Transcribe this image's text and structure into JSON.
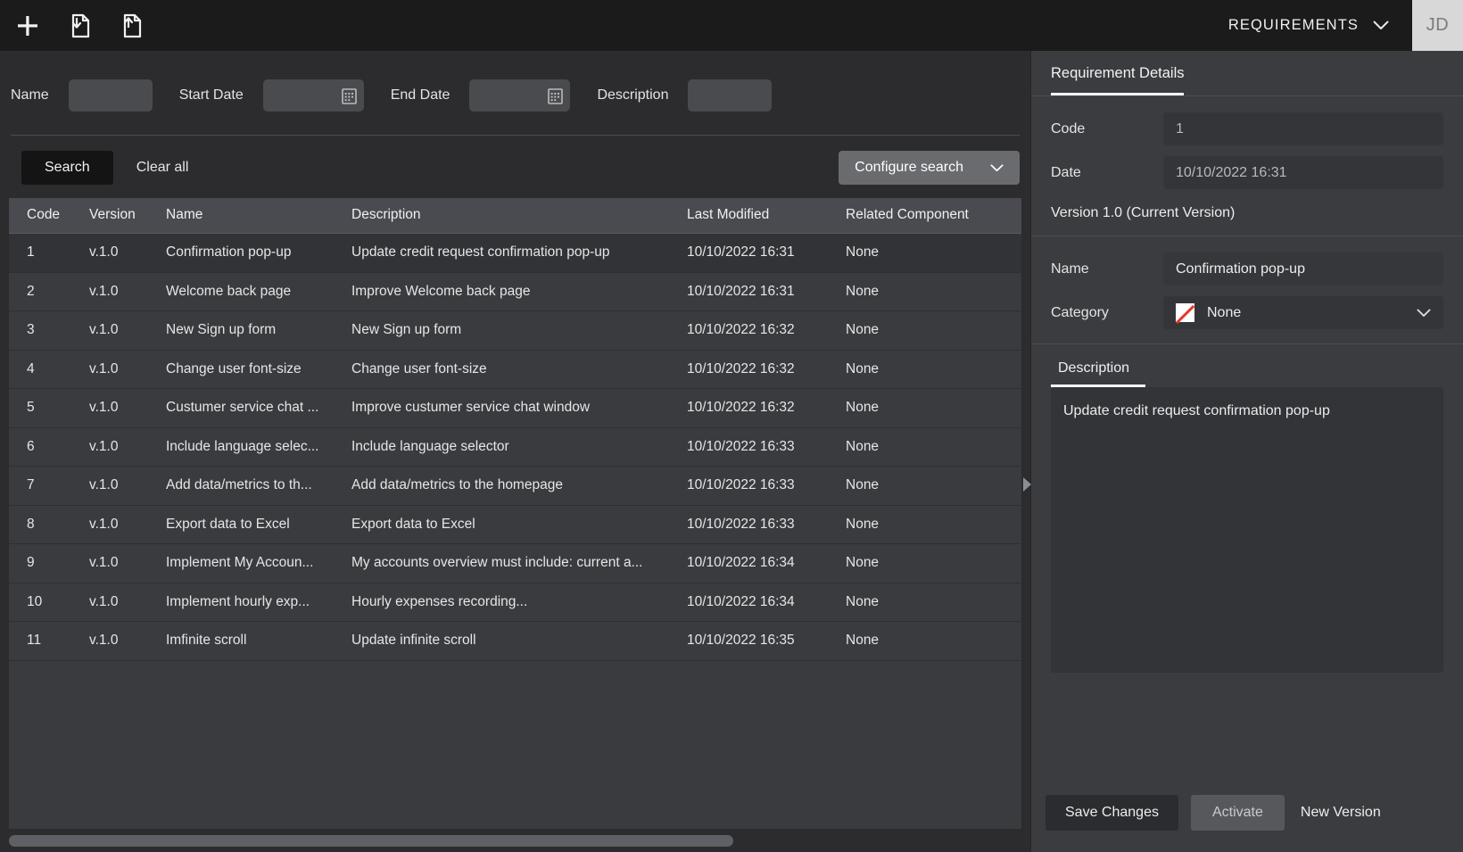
{
  "topbar": {
    "tools": [
      {
        "name": "add-icon",
        "label": "New"
      },
      {
        "name": "import-file-icon",
        "label": "Import"
      },
      {
        "name": "export-file-icon",
        "label": "Export"
      }
    ],
    "module": "REQUIREMENTS",
    "avatar_initials": "JD"
  },
  "filters": {
    "name_label": "Name",
    "name_value": "",
    "start_date_label": "Start Date",
    "start_date_value": "",
    "end_date_label": "End Date",
    "end_date_value": "",
    "description_label": "Description",
    "description_value": ""
  },
  "actions": {
    "search": "Search",
    "clear_all": "Clear all",
    "configure_search": "Configure search"
  },
  "table": {
    "columns": [
      "Code",
      "Version",
      "Name",
      "Description",
      "Last Modified",
      "Related Component"
    ],
    "rows": [
      {
        "code": "1",
        "version": "v.1.0",
        "name": "Confirmation pop-up",
        "description": "Update credit request confirmation pop-up",
        "modified": "10/10/2022 16:31",
        "related": "None",
        "selected": true
      },
      {
        "code": "2",
        "version": "v.1.0",
        "name": "Welcome back page",
        "description": "Improve Welcome back page",
        "modified": "10/10/2022 16:31",
        "related": "None",
        "selected": false
      },
      {
        "code": "3",
        "version": "v.1.0",
        "name": "New Sign up form",
        "description": "New Sign up form",
        "modified": "10/10/2022 16:32",
        "related": "None",
        "selected": false
      },
      {
        "code": "4",
        "version": "v.1.0",
        "name": "Change user font-size",
        "description": "Change user font-size",
        "modified": "10/10/2022 16:32",
        "related": "None",
        "selected": false
      },
      {
        "code": "5",
        "version": "v.1.0",
        "name": "Custumer service chat ...",
        "description": "Improve custumer service chat window",
        "modified": "10/10/2022 16:32",
        "related": "None",
        "selected": false
      },
      {
        "code": "6",
        "version": "v.1.0",
        "name": "Include language selec...",
        "description": "Include language selector",
        "modified": "10/10/2022 16:33",
        "related": "None",
        "selected": false
      },
      {
        "code": "7",
        "version": "v.1.0",
        "name": "Add data/metrics to th...",
        "description": "Add data/metrics to the homepage",
        "modified": "10/10/2022 16:33",
        "related": "None",
        "selected": false
      },
      {
        "code": "8",
        "version": "v.1.0",
        "name": "Export data to Excel",
        "description": "Export data to Excel",
        "modified": "10/10/2022 16:33",
        "related": "None",
        "selected": false
      },
      {
        "code": "9",
        "version": "v.1.0",
        "name": "Implement My Accoun...",
        "description": "My accounts overview must include: current a...",
        "modified": "10/10/2022 16:34",
        "related": "None",
        "selected": false
      },
      {
        "code": "10",
        "version": "v.1.0",
        "name": "Implement hourly exp...",
        "description": "Hourly expenses recording...",
        "modified": "10/10/2022 16:34",
        "related": "None",
        "selected": false
      },
      {
        "code": "11",
        "version": "v.1.0",
        "name": "Imfinite scroll",
        "description": "Update infinite scroll",
        "modified": "10/10/2022 16:35",
        "related": "None",
        "selected": false
      }
    ]
  },
  "panel": {
    "tab": "Requirement Details",
    "code_label": "Code",
    "code_value": "1",
    "date_label": "Date",
    "date_value": "10/10/2022 16:31",
    "version_line": "Version 1.0 (Current Version)",
    "name_label": "Name",
    "name_value": "Confirmation pop-up",
    "category_label": "Category",
    "category_value": "None",
    "description_tab": "Description",
    "description_value": "Update credit request confirmation pop-up",
    "save_label": "Save Changes",
    "activate_label": "Activate",
    "new_version_label": "New Version"
  },
  "colors": {
    "topbar_bg": "#1b1b1b",
    "main_bg": "#2c2c2e",
    "panel_bg": "#3b3c40",
    "row_bg": "#3a3b3f",
    "row_selected_bg": "#323337",
    "header_row_bg": "#4a4b50",
    "accent_underline": "#ffffff",
    "category_none_slash": "#e8352b",
    "avatar_bg": "#d8d8d8"
  }
}
